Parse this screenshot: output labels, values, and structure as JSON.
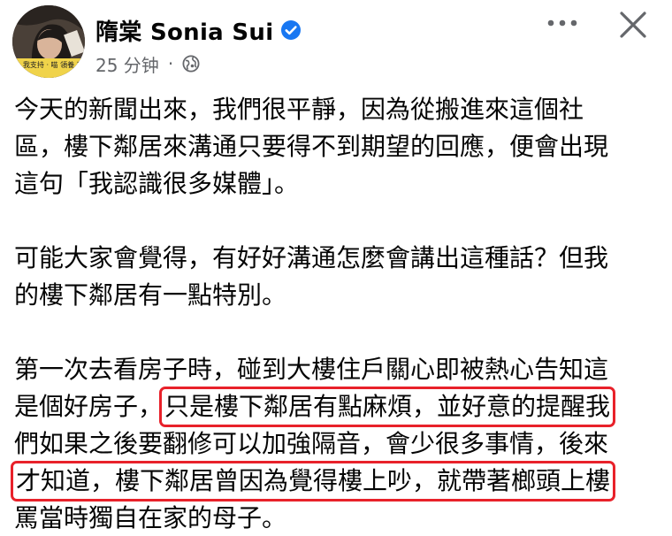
{
  "post": {
    "author_name": "隋棠 Sonia Sui",
    "timestamp": "25 分钟",
    "separator": "·",
    "avatar_caption": "十一 我支持 · 喵 領養 不買",
    "paragraphs": [
      {
        "lines": [
          {
            "segments": [
              "今天的新聞出來，我們很平靜，因為從搬進來這個社"
            ]
          },
          {
            "segments": [
              "區，樓下鄰居來溝通只要得不到期望的回應，便會出現"
            ]
          },
          {
            "segments": [
              "這句「我認識很多媒體」。"
            ]
          }
        ]
      },
      {
        "lines": [
          {
            "segments": [
              "可能大家會覺得，有好好溝通怎麼會講出這種話？但我"
            ]
          },
          {
            "segments": [
              "的樓下鄰居有一點特別。"
            ]
          }
        ]
      },
      {
        "lines": [
          {
            "segments": [
              "第一次去看房子時，碰到大樓住戶關心即被熱心告知這"
            ]
          },
          {
            "segments": [
              "是個好房子，",
              "只是樓下鄰居有點麻煩，並好意的提醒我"
            ]
          },
          {
            "segments": [
              "們如果之後要翻修可以加強隔音，會少很多事情，後來"
            ]
          },
          {
            "segments": [
              "",
              "才知道，樓下鄰居曾因為覺得樓上吵，就帶著榔頭上樓"
            ]
          },
          {
            "segments": [
              "罵當時獨自在家的母子。"
            ]
          }
        ]
      }
    ]
  },
  "icons": {
    "verified": "verified-badge-icon",
    "audience": "globe-icon",
    "more": "more-options-icon",
    "close": "close-icon"
  },
  "colors": {
    "verified_blue": "#1877f2",
    "highlight_red": "#e8212a",
    "meta_gray": "#65676b",
    "text": "#050505"
  }
}
